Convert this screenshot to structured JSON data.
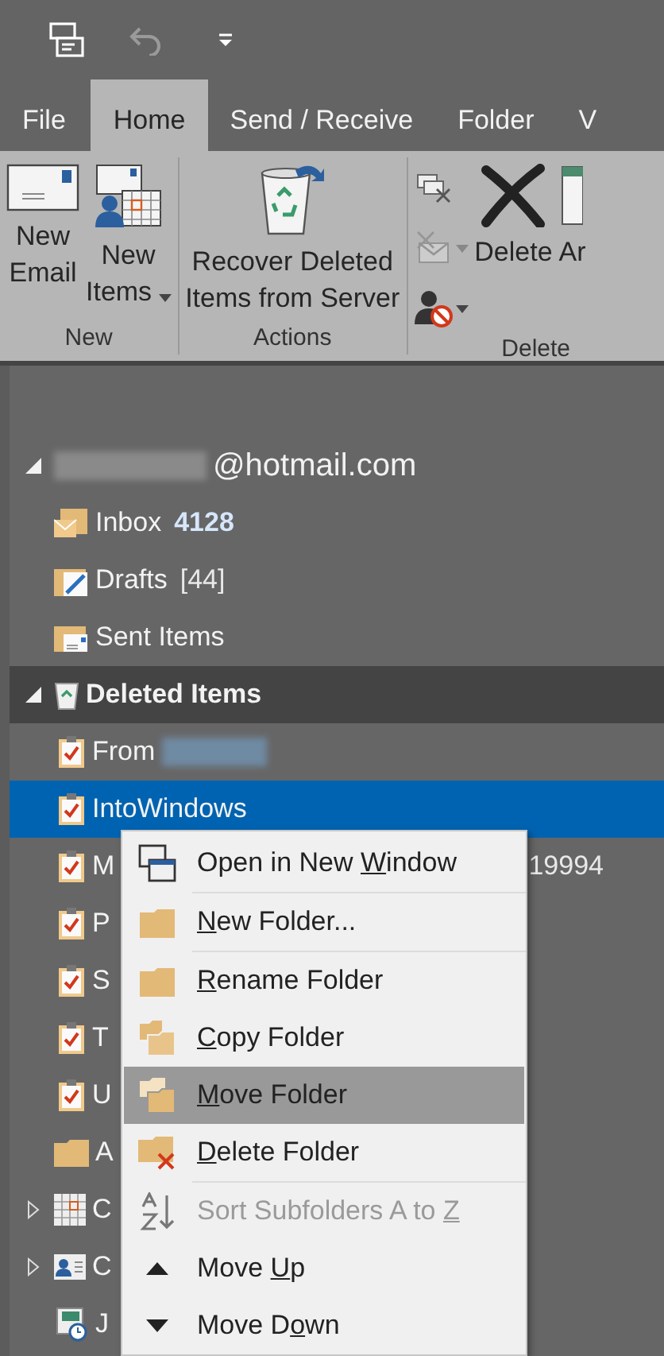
{
  "quick_access": [
    {
      "kind": "send_receive",
      "disabled": false
    },
    {
      "kind": "undo",
      "disabled": true
    },
    {
      "kind": "customize",
      "disabled": false
    }
  ],
  "tabs": [
    {
      "label": "File",
      "selected": false
    },
    {
      "label": "Home",
      "selected": true
    },
    {
      "label": "Send / Receive",
      "selected": false
    },
    {
      "label": "Folder",
      "selected": false
    },
    {
      "label": "V",
      "selected": false
    }
  ],
  "ribbon": {
    "groups": [
      {
        "label": "New",
        "buttons": [
          {
            "kind": "new_email",
            "lines": [
              "New",
              "Email"
            ]
          },
          {
            "kind": "new_items",
            "lines": [
              "New",
              "Items"
            ],
            "dropdown": true
          }
        ]
      },
      {
        "label": "Actions",
        "buttons": [
          {
            "kind": "recover",
            "lines": [
              "Recover Deleted",
              "Items from Server"
            ]
          }
        ]
      },
      {
        "label": "Delete",
        "small_buttons": [
          {
            "kind": "ignore",
            "disabled": false
          },
          {
            "kind": "clean_up",
            "disabled": true,
            "dropdown": true
          },
          {
            "kind": "junk",
            "disabled": false,
            "dropdown": true
          }
        ],
        "buttons": [
          {
            "kind": "delete",
            "lines": [
              "Delete"
            ]
          },
          {
            "kind": "archive",
            "lines": [
              "Ar"
            ]
          }
        ]
      }
    ]
  },
  "folders": [
    {
      "label": "@hotmail.com",
      "redacted": true,
      "expanded": true,
      "selected": false,
      "current": false,
      "children": [
        {
          "label": "Inbox",
          "kind": "inbox",
          "count": "4128",
          "count_bold": true,
          "selected": false,
          "current": false
        },
        {
          "label": "Drafts",
          "kind": "drafts",
          "count": "[44]",
          "count_bold": false,
          "selected": false,
          "current": false
        },
        {
          "label": "Sent Items",
          "kind": "sent",
          "selected": false,
          "current": false
        },
        {
          "label": "Deleted Items",
          "kind": "deleted",
          "expanded": true,
          "selected": false,
          "current": true,
          "children": [
            {
              "label": "From",
              "kind": "task",
              "redacted": true,
              "selected": false,
              "current": false
            },
            {
              "label": "IntoWindows",
              "kind": "task",
              "selected": true,
              "current": false
            },
            {
              "label": "M",
              "kind": "task",
              "count": "19994",
              "count_bold": false,
              "selected": false,
              "current": false
            },
            {
              "label": "P",
              "kind": "task",
              "selected": false,
              "current": false
            },
            {
              "label": "S",
              "kind": "task",
              "selected": false,
              "current": false
            },
            {
              "label": "T",
              "kind": "task",
              "selected": false,
              "current": false
            },
            {
              "label": "U",
              "kind": "task",
              "selected": false,
              "current": false
            }
          ]
        },
        {
          "label": "A",
          "kind": "folder",
          "selected": false,
          "current": false
        },
        {
          "label": "C",
          "kind": "calendar",
          "expanded": false,
          "selected": false,
          "current": false
        },
        {
          "label": "C",
          "kind": "contacts",
          "expanded": false,
          "selected": false,
          "current": false
        },
        {
          "label": "J",
          "kind": "journal",
          "selected": false,
          "current": false
        }
      ]
    }
  ],
  "context_menu": {
    "items": [
      {
        "kind": "open_window",
        "label": {
          "before": "Open in New ",
          "key": "W",
          "after": "indow"
        },
        "disabled": false,
        "selected": false,
        "separator_after": true
      },
      {
        "kind": "new_folder",
        "label": {
          "key": "N",
          "after": "ew Folder..."
        },
        "disabled": false,
        "selected": false,
        "separator_after": true
      },
      {
        "kind": "rename",
        "label": {
          "key": "R",
          "after": "ename Folder"
        },
        "disabled": false,
        "selected": false
      },
      {
        "kind": "copy",
        "label": {
          "key": "C",
          "after": "opy Folder"
        },
        "disabled": false,
        "selected": false
      },
      {
        "kind": "move",
        "label": {
          "key": "M",
          "after": "ove Folder"
        },
        "disabled": false,
        "selected": true
      },
      {
        "kind": "delete",
        "label": {
          "key": "D",
          "after": "elete Folder"
        },
        "disabled": false,
        "selected": false,
        "separator_after": true
      },
      {
        "kind": "sort",
        "label": {
          "before": "Sort Subfolders A to ",
          "key": "Z"
        },
        "disabled": true,
        "selected": false
      },
      {
        "kind": "up",
        "label": {
          "before": "Move ",
          "key": "U",
          "after": "p"
        },
        "disabled": false,
        "selected": false
      },
      {
        "kind": "down",
        "label": {
          "before": "Move D",
          "key": "o",
          "after": "wn"
        },
        "disabled": false,
        "selected": false
      }
    ]
  }
}
